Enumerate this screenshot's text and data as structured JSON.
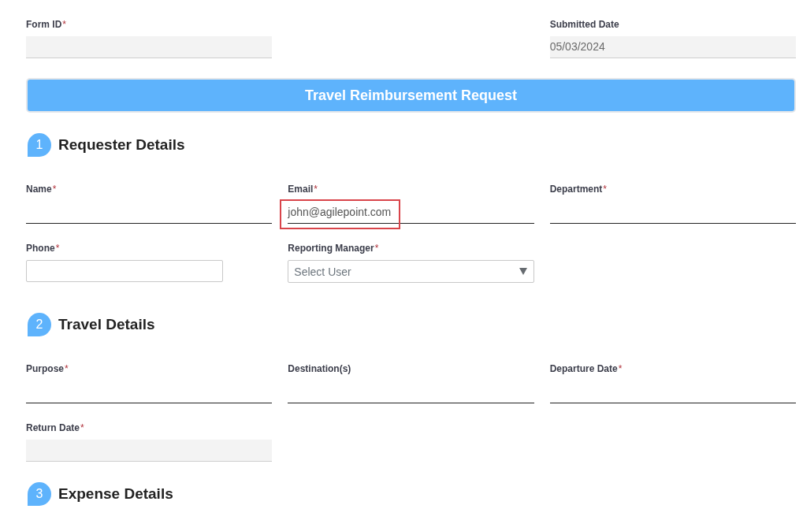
{
  "required_mark": "*",
  "form_header": {
    "fields": [
      {
        "kind": "readonly",
        "label": "Form ID",
        "required": true,
        "highlighted": false
      },
      {
        "kind": "readonly",
        "label": "Submitted Date",
        "required": false,
        "value": "05/03/2024",
        "highlighted": false
      }
    ]
  },
  "banner": {
    "title": "Travel Reimbursement Request"
  },
  "sections": [
    {
      "number": "1",
      "title": "Requester Details",
      "rows": [
        [
          {
            "kind": "underline",
            "label": "Name",
            "required": true,
            "highlighted": false
          },
          {
            "kind": "underline",
            "label": "Email",
            "required": true,
            "value": "john@agilepoint.com",
            "highlighted": true
          },
          {
            "kind": "underline",
            "label": "Department",
            "required": true,
            "highlighted": false
          }
        ],
        [
          {
            "kind": "box",
            "label": "Phone",
            "required": true,
            "highlighted": false
          },
          {
            "kind": "select",
            "label": "Reporting Manager",
            "required": true,
            "placeholder": "Select User",
            "highlighted": false
          }
        ]
      ]
    },
    {
      "number": "2",
      "title": "Travel Details",
      "rows": [
        [
          {
            "kind": "underline",
            "label": "Purpose",
            "required": true,
            "highlighted": false
          },
          {
            "kind": "underline",
            "label": "Destination(s)",
            "required": false,
            "highlighted": false
          },
          {
            "kind": "underline",
            "label": "Departure Date",
            "required": true,
            "highlighted": false
          }
        ],
        [
          {
            "kind": "readonly",
            "label": "Return Date",
            "required": true,
            "highlighted": false
          }
        ]
      ]
    },
    {
      "number": "3",
      "title": "Expense Details"
    }
  ]
}
